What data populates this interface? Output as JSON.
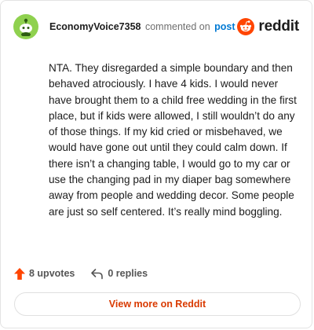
{
  "comment": {
    "username": "EconomyVoice7358",
    "action_text": "commented on",
    "post_link_text": "post",
    "body": "NTA. They disregarded a simple boundary and then behaved atrociously. I have 4 kids. I would never have brought them to a child free wedding in the first place, but if kids were allowed, I still wouldn’t do any of those things. If my kid cried or misbehaved, we would have gone out until they could calm down. If there isn’t a changing table, I would go to my car or use the changing pad in my diaper bag somewhere away from people and wedding decor. Some people are just so self centered. It’s really mind boggling.",
    "upvotes_label": "8 upvotes",
    "replies_label": "0 replies"
  },
  "brand": {
    "wordmark": "reddit",
    "icon": "reddit-logo-icon"
  },
  "actions": {
    "view_more_label": "View more on Reddit"
  },
  "colors": {
    "brand_orange": "#ff4500",
    "link_blue": "#0079d3",
    "view_more_text": "#d93a00",
    "avatar_bg": "#8fd14f"
  }
}
